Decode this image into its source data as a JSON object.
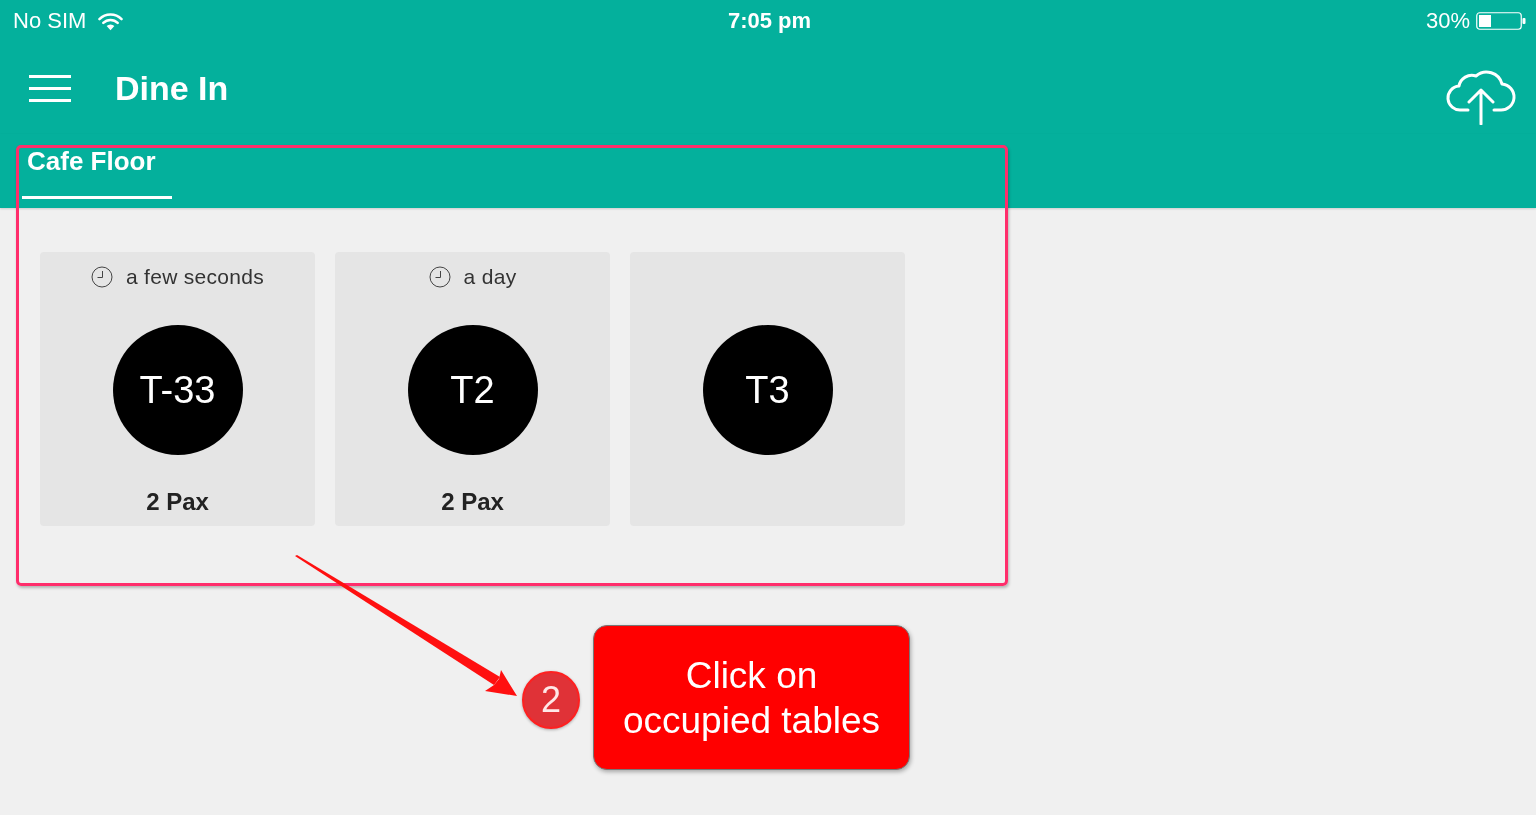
{
  "status_bar": {
    "carrier": "No SIM",
    "time": "7:05 pm",
    "battery": "30%"
  },
  "app_bar": {
    "title": "Dine In"
  },
  "tabs": [
    {
      "label": "Cafe Floor",
      "selected": true
    }
  ],
  "tables": [
    {
      "elapsed": "a few seconds",
      "name": "T-33",
      "pax": "2 Pax"
    },
    {
      "elapsed": "a day",
      "name": "T2",
      "pax": "2 Pax"
    },
    {
      "name": "T3"
    }
  ],
  "annotation": {
    "step": "2",
    "note": "Click on occupied tables"
  }
}
